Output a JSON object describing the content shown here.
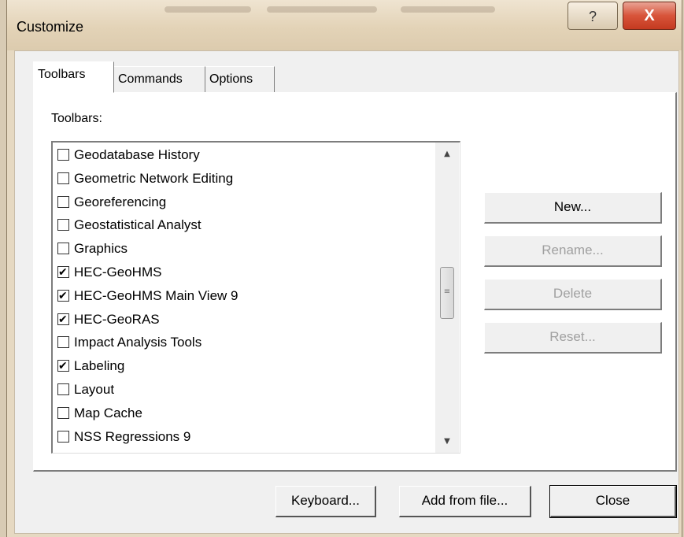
{
  "window": {
    "title": "Customize",
    "help_glyph": "?",
    "close_glyph": "X"
  },
  "tabs": [
    {
      "label": "Toolbars",
      "active": true
    },
    {
      "label": "Commands",
      "active": false
    },
    {
      "label": "Options",
      "active": false
    }
  ],
  "panel": {
    "toolbars_label": "Toolbars:"
  },
  "toolbar_list": [
    {
      "label": "Geodatabase History",
      "checked": false
    },
    {
      "label": "Geometric Network Editing",
      "checked": false
    },
    {
      "label": "Georeferencing",
      "checked": false
    },
    {
      "label": "Geostatistical Analyst",
      "checked": false
    },
    {
      "label": "Graphics",
      "checked": false
    },
    {
      "label": "HEC-GeoHMS",
      "checked": true
    },
    {
      "label": "HEC-GeoHMS Main View 9",
      "checked": true
    },
    {
      "label": "HEC-GeoRAS",
      "checked": true
    },
    {
      "label": "Impact Analysis Tools",
      "checked": false
    },
    {
      "label": "Labeling",
      "checked": true
    },
    {
      "label": "Layout",
      "checked": false
    },
    {
      "label": "Map Cache",
      "checked": false
    },
    {
      "label": "NSS Regressions 9",
      "checked": false
    }
  ],
  "scrollbar": {
    "up_glyph": "▲",
    "down_glyph": "▼",
    "thumb_glyph": "≡"
  },
  "side_buttons": [
    {
      "label": "New...",
      "enabled": true
    },
    {
      "label": "Rename...",
      "enabled": false
    },
    {
      "label": "Delete",
      "enabled": false
    },
    {
      "label": "Reset...",
      "enabled": false
    }
  ],
  "bottom_buttons": {
    "keyboard": "Keyboard...",
    "add_from_file": "Add from file...",
    "close": "Close"
  }
}
